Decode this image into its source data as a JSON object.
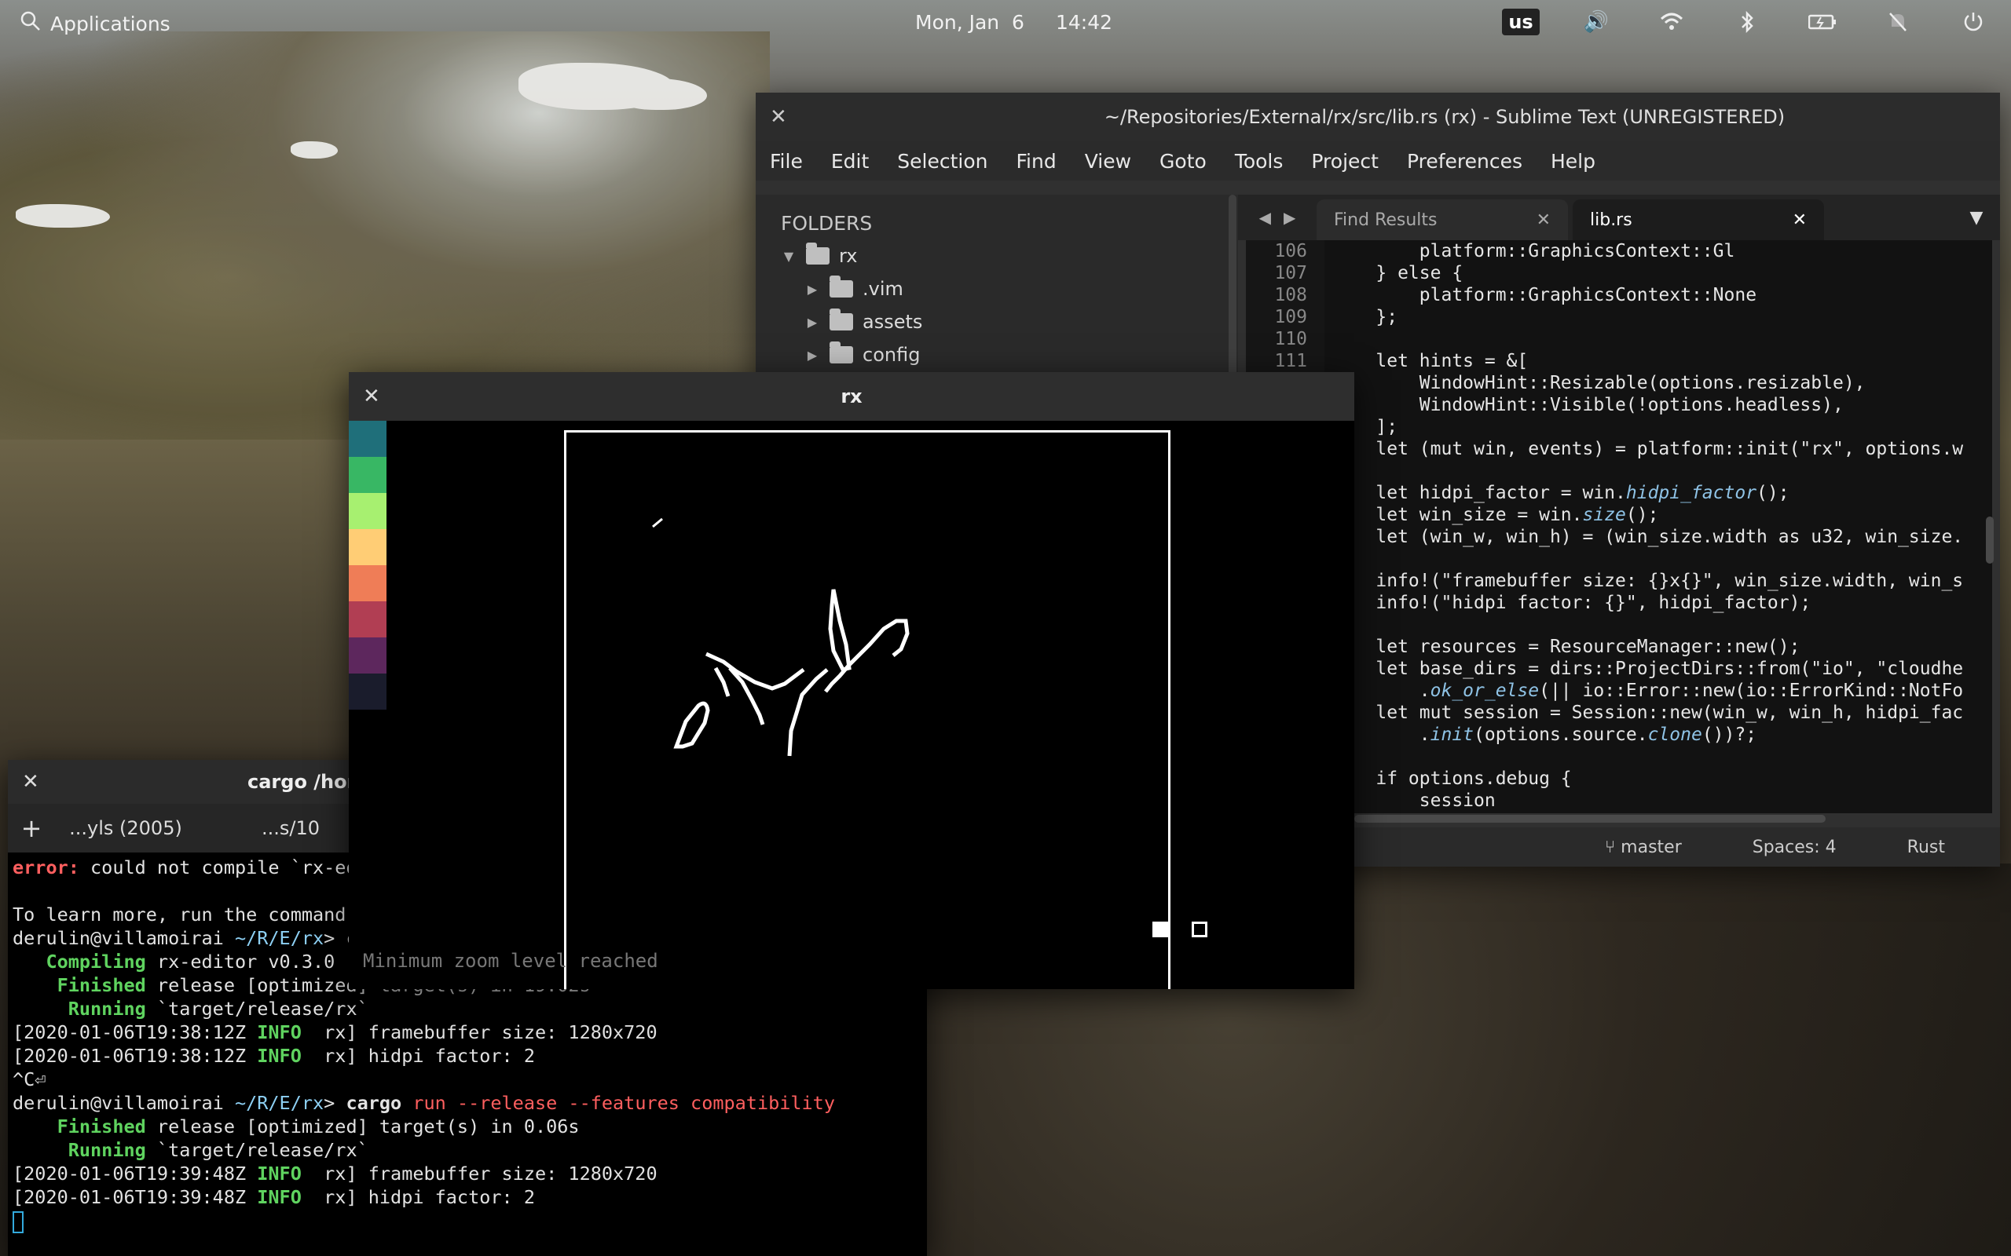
{
  "topbar": {
    "applications": "Applications",
    "date": "Mon, Jan  6",
    "time": "14:42",
    "keyboard": "us"
  },
  "sublime": {
    "title": "~/Repositories/External/rx/src/lib.rs (rx) - Sublime Text (UNREGISTERED)",
    "menu": [
      "File",
      "Edit",
      "Selection",
      "Find",
      "View",
      "Goto",
      "Tools",
      "Project",
      "Preferences",
      "Help"
    ],
    "sidebar_header": "FOLDERS",
    "root_folder": "rx",
    "folders": [
      ".vim",
      "assets",
      "config"
    ],
    "tabs": [
      "Find Results",
      "lib.rs"
    ],
    "line_numbers": [
      "106",
      "107",
      "108",
      "109",
      "110",
      "111",
      "",
      "",
      "",
      "",
      "",
      "",
      "",
      "",
      "",
      "",
      "",
      "",
      "",
      "",
      "",
      "",
      "",
      "",
      ""
    ],
    "code": [
      "        platform::GraphicsContext::Gl",
      "    } else {",
      "        platform::GraphicsContext::None",
      "    };",
      "",
      "    let hints = &[",
      "        WindowHint::Resizable(options.resizable),",
      "        WindowHint::Visible(!options.headless),",
      "    ];",
      "    let (mut win, events) = platform::init(\"rx\", options.w",
      "",
      "    let hidpi_factor = win.hidpi_factor();",
      "    let win_size = win.size();",
      "    let (win_w, win_h) = (win_size.width as u32, win_size.",
      "",
      "    info!(\"framebuffer size: {}x{}\", win_size.width, win_s",
      "    info!(\"hidpi factor: {}\", hidpi_factor);",
      "",
      "    let resources = ResourceManager::new();",
      "    let base_dirs = dirs::ProjectDirs::from(\"io\", \"cloudhe",
      "        .ok_or_else(|| io::Error::new(io::ErrorKind::NotFo",
      "    let mut session = Session::new(win_w, win_h, hidpi_fac",
      "        .init(options.source.clone())?;",
      "",
      "    if options.debug {",
      "        session"
    ],
    "status": {
      "branch": "master",
      "spaces": "Spaces: 4",
      "syntax": "Rust"
    }
  },
  "rx": {
    "title": "rx",
    "palette": [
      "#1f6f7a",
      "#38b764",
      "#a7f070",
      "#ffcd75",
      "#ef7d57",
      "#b13e53",
      "#5d275d",
      "#1a1c2c"
    ],
    "zoom_message": "Minimum zoom level reached"
  },
  "terminal": {
    "title": "cargo /hor",
    "tabs": [
      "...yls (2005)",
      "...s/10"
    ],
    "lines": [
      {
        "parts": [
          {
            "t": "error:",
            "c": "red"
          },
          {
            "t": " could not compile `rx-ed",
            "c": ""
          }
        ]
      },
      {
        "parts": [
          {
            "t": "",
            "c": ""
          }
        ]
      },
      {
        "parts": [
          {
            "t": "To learn more, run the command",
            "c": ""
          }
        ]
      },
      {
        "parts": [
          {
            "t": "derulin@villamoirai ",
            "c": ""
          },
          {
            "t": "~/R/E/rx",
            "c": "cyan"
          },
          {
            "t": "> c",
            "c": ""
          }
        ]
      },
      {
        "parts": [
          {
            "t": "   Compiling",
            "c": "green"
          },
          {
            "t": " rx-editor v0.3.0 (",
            "c": ""
          }
        ]
      },
      {
        "parts": [
          {
            "t": "    Finished",
            "c": "green"
          },
          {
            "t": " release [optimized] target(s) in 19.02s",
            "c": ""
          }
        ]
      },
      {
        "parts": [
          {
            "t": "     Running",
            "c": "green"
          },
          {
            "t": " `target/release/rx`",
            "c": ""
          }
        ]
      },
      {
        "parts": [
          {
            "t": "[2020-01-06T19:38:12Z ",
            "c": ""
          },
          {
            "t": "INFO",
            "c": "green"
          },
          {
            "t": "  rx] framebuffer size: 1280x720",
            "c": ""
          }
        ]
      },
      {
        "parts": [
          {
            "t": "[2020-01-06T19:38:12Z ",
            "c": ""
          },
          {
            "t": "INFO",
            "c": "green"
          },
          {
            "t": "  rx] hidpi factor: 2",
            "c": ""
          }
        ]
      },
      {
        "parts": [
          {
            "t": "^C⏎",
            "c": ""
          }
        ]
      },
      {
        "parts": [
          {
            "t": "derulin@villamoirai ",
            "c": ""
          },
          {
            "t": "~/R/E/rx",
            "c": "cyan"
          },
          {
            "t": "> ",
            "c": ""
          },
          {
            "t": "cargo",
            "c": "bold"
          },
          {
            "t": " run --release --features compatibility",
            "c": "red-plain"
          }
        ]
      },
      {
        "parts": [
          {
            "t": "    Finished",
            "c": "green"
          },
          {
            "t": " release [optimized] target(s) in 0.06s",
            "c": ""
          }
        ]
      },
      {
        "parts": [
          {
            "t": "     Running",
            "c": "green"
          },
          {
            "t": " `target/release/rx`",
            "c": ""
          }
        ]
      },
      {
        "parts": [
          {
            "t": "[2020-01-06T19:39:48Z ",
            "c": ""
          },
          {
            "t": "INFO",
            "c": "green"
          },
          {
            "t": "  rx] framebuffer size: 1280x720",
            "c": ""
          }
        ]
      },
      {
        "parts": [
          {
            "t": "[2020-01-06T19:39:48Z ",
            "c": ""
          },
          {
            "t": "INFO",
            "c": "green"
          },
          {
            "t": "  rx] hidpi factor: 2",
            "c": ""
          }
        ]
      }
    ]
  }
}
